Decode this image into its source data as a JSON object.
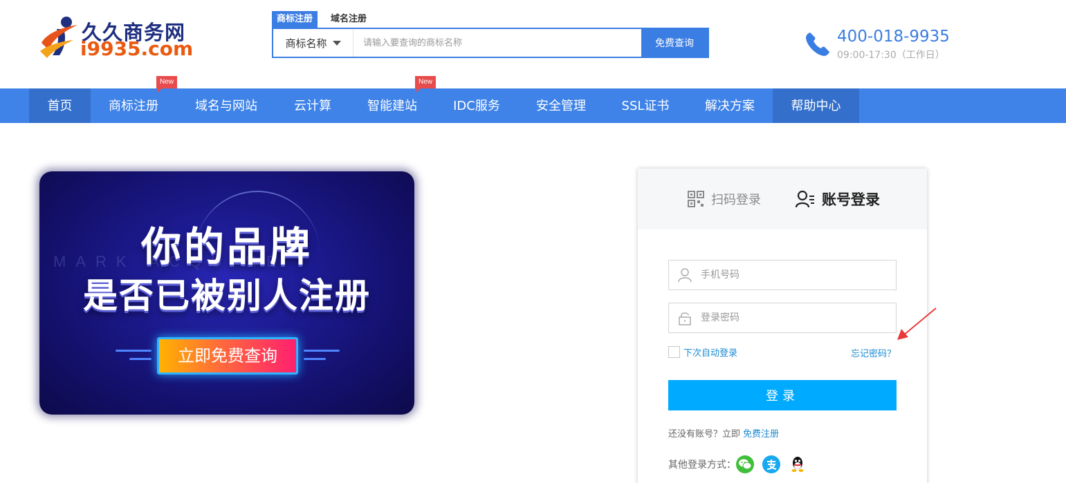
{
  "logo": {
    "cn": "久久商务网",
    "en": "i9935.com"
  },
  "search": {
    "tabs": [
      "商标注册",
      "域名注册"
    ],
    "select_label": "商标名称",
    "placeholder": "请输入要查询的商标名称",
    "button_label": "免费查询"
  },
  "hotline": {
    "number": "400-018-9935",
    "hours": "09:00-17:30（工作日）"
  },
  "nav": {
    "items": [
      "首页",
      "商标注册",
      "域名与网站",
      "云计算",
      "智能建站",
      "IDC服务",
      "安全管理",
      "SSL证书",
      "解决方案",
      "帮助中心"
    ],
    "badge": "New"
  },
  "banner": {
    "line1": "你的品牌",
    "line2": "是否已被别人注册",
    "cta": "立即免费查询",
    "watermark": "MARK ACQUIRE"
  },
  "login": {
    "tab_qr": "扫码登录",
    "tab_account": "账号登录",
    "phone_placeholder": "手机号码",
    "password_placeholder": "登录密码",
    "remember_label": "下次自动登录",
    "forgot_label": "忘记密码？",
    "submit_label": "登录",
    "register_prefix": "还没有账号？立即",
    "register_link": "免费注册",
    "other_label": "其他登录方式：",
    "social": [
      "wechat-icon",
      "alipay-icon",
      "qq-icon"
    ]
  },
  "colors": {
    "brand_blue": "#3f83e8",
    "nav_active": "#3470cb",
    "login_button": "#00aaff",
    "badge": "#e84b4b"
  }
}
